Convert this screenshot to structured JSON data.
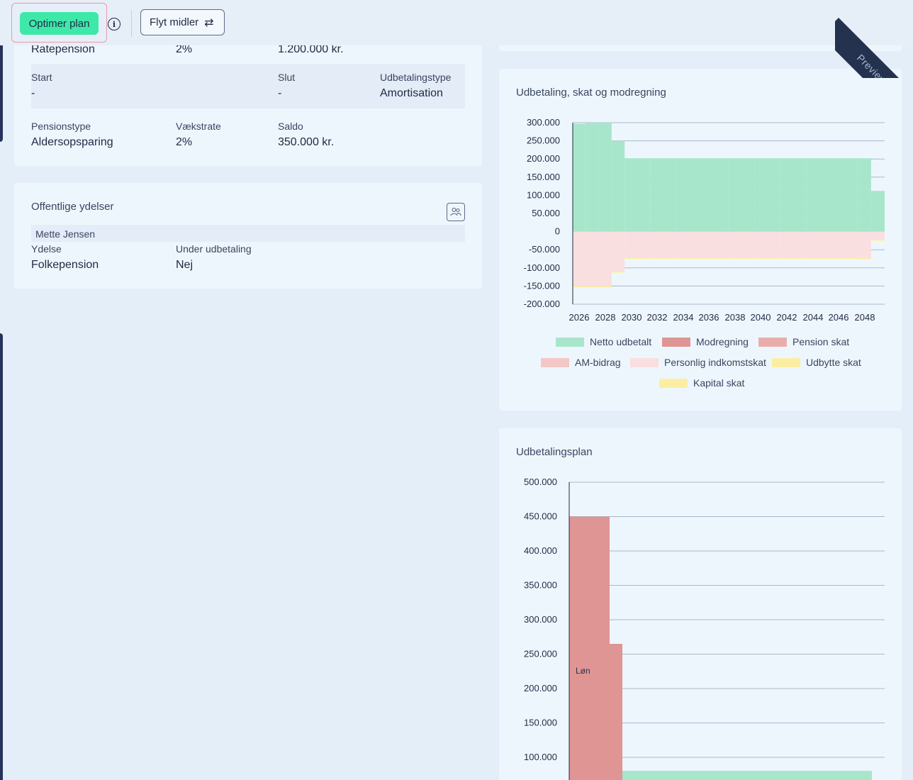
{
  "toolbar": {
    "optimize_label": "Optimer plan",
    "move_funds_label": "Flyt midler",
    "swap_glyph": "⇄",
    "info_glyph": "i",
    "preview_label": "Preview"
  },
  "pension_card": {
    "partial_row": {
      "type": "Ratepension",
      "rate": "2%",
      "balance": "1.200.000 kr."
    },
    "payout_row": {
      "start_label": "Start",
      "start_value": "-",
      "end_label": "Slut",
      "end_value": "-",
      "type_label": "Udbetalingstype",
      "type_value": "Amortisation"
    },
    "row2": {
      "type_label": "Pensionstype",
      "type_value": "Aldersopsparing",
      "rate_label": "Vækstrate",
      "rate_value": "2%",
      "balance_label": "Saldo",
      "balance_value": "350.000 kr."
    }
  },
  "public_benefits": {
    "title": "Offentlige ydelser",
    "person": "Mette Jensen",
    "benefit_label": "Ydelse",
    "benefit_value": "Folkepension",
    "paying_label": "Under udbetaling",
    "paying_value": "Nej"
  },
  "colors": {
    "netto": "#a8e6cb",
    "modregning": "#df9593",
    "pension_skat": "#e8adab",
    "am_bidrag": "#f4c7c7",
    "personlig": "#f9dfe0",
    "udbytte": "#fbeea3",
    "kapital": "#fbeea3"
  },
  "chart_data": [
    {
      "type": "area",
      "title": "Udbetaling, skat og modregning",
      "x": [
        2026,
        2027,
        2028,
        2029,
        2030,
        2032,
        2034,
        2036,
        2038,
        2040,
        2042,
        2044,
        2046,
        2048,
        2049
      ],
      "xticks": [
        "2026",
        "2028",
        "2030",
        "2032",
        "2034",
        "2036",
        "2038",
        "2040",
        "2042",
        "2044",
        "2046",
        "2048"
      ],
      "yticks": [
        "300.000",
        "250.000",
        "200.000",
        "150.000",
        "100.000",
        "50.000",
        "0",
        "-50.000",
        "-100.000",
        "-150.000",
        "-200.000"
      ],
      "ylim": [
        -200000,
        300000
      ],
      "series": [
        {
          "name": "Netto udbetalt",
          "values": [
            297000,
            300000,
            300000,
            250000,
            202000,
            202000,
            202000,
            202000,
            202000,
            202000,
            202000,
            202000,
            202000,
            202000,
            112000
          ]
        },
        {
          "name": "Modregning",
          "values": [
            0,
            0,
            0,
            0,
            0,
            0,
            0,
            0,
            0,
            0,
            0,
            0,
            0,
            0,
            0
          ]
        },
        {
          "name": "Pension skat",
          "values": [
            0,
            0,
            0,
            0,
            0,
            0,
            0,
            0,
            0,
            0,
            0,
            0,
            0,
            0,
            0
          ]
        },
        {
          "name": "AM-bidrag",
          "values": [
            0,
            0,
            0,
            0,
            0,
            0,
            0,
            0,
            0,
            0,
            0,
            0,
            0,
            0,
            0
          ]
        },
        {
          "name": "Personlig indkomstskat",
          "values": [
            -150000,
            -150000,
            -150000,
            -110000,
            -72000,
            -72000,
            -72000,
            -72000,
            -72000,
            -72000,
            -72000,
            -72000,
            -72000,
            -72000,
            -22000
          ]
        },
        {
          "name": "Udbytte skat",
          "values": [
            -4000,
            -4000,
            -4000,
            -3000,
            -3000,
            -3000,
            -3000,
            -3000,
            -3000,
            -3000,
            -3000,
            -3000,
            -3000,
            -4000,
            -3000
          ]
        },
        {
          "name": "Kapital skat",
          "values": [
            0,
            0,
            0,
            0,
            0,
            0,
            0,
            0,
            0,
            0,
            0,
            0,
            0,
            0,
            0
          ]
        }
      ],
      "legend": [
        "Netto udbetalt",
        "Modregning",
        "Pension skat",
        "AM-bidrag",
        "Personlig indkomstskat",
        "Udbytte skat",
        "Kapital skat"
      ],
      "legend_position": "bottom"
    },
    {
      "type": "area",
      "title": "Udbetalingsplan",
      "yticks": [
        "500.000",
        "450.000",
        "400.000",
        "350.000",
        "300.000",
        "250.000",
        "200.000",
        "150.000",
        "100.000"
      ],
      "series": [
        {
          "name": "Løn",
          "values": [
            450000,
            450000,
            450000,
            265000
          ]
        },
        {
          "name": "",
          "values": [
            0,
            0,
            0,
            0,
            80000
          ]
        }
      ],
      "annotation": "Løn"
    }
  ]
}
